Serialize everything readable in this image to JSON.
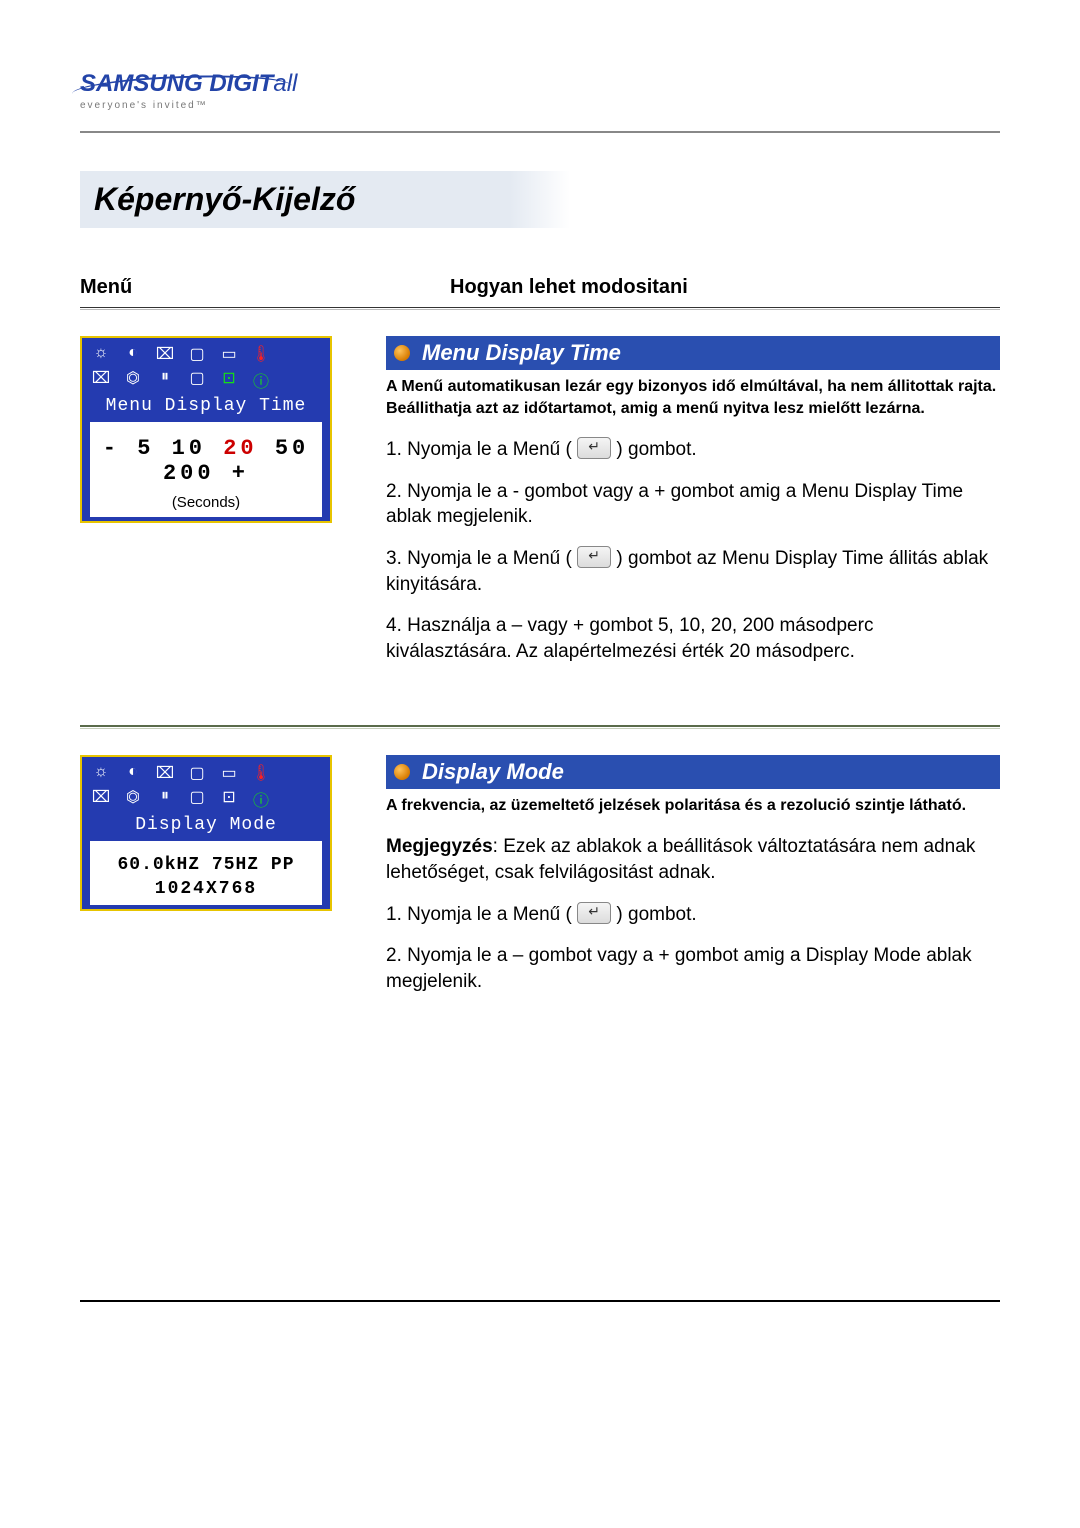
{
  "logo": {
    "line1_brand": "SAMSUNG",
    "line1_word": "DIGIT",
    "line1_suffix": "all",
    "tagline": "everyone's invited™"
  },
  "page_title": "Képernyő-Kijelző",
  "columns": {
    "menu": "Menű",
    "how": "Hogyan lehet modositani"
  },
  "osd1": {
    "title": "Menu Display Time",
    "values": [
      "5",
      "10",
      "20",
      "50",
      "200"
    ],
    "units": "(Seconds)"
  },
  "osd2": {
    "title": "Display Mode",
    "line1": "60.0kHZ 75HZ PP",
    "line2": "1024X768"
  },
  "section1": {
    "title": "Menu Display Time",
    "intro": "A Menű automatikusan lezár egy bizonyos idő elmúltával, ha nem állitottak rajta. Beállithatja azt az időtartamot, amig a menű nyitva lesz mielőtt lezárna.",
    "step1a": "1. Nyomja le a Menű  ( ",
    "step1b": " ) gombot.",
    "step2": "2. Nyomja le a - gombot vagy a + gombot amig a Menu Display Time ablak megjelenik.",
    "step3a": "3. Nyomja le a Menű ( ",
    "step3b": " ) gombot az Menu Display Time állitás ablak kinyitására.",
    "step4": "4. Használja a – vagy + gombot 5, 10, 20, 200 másodperc kiválasztására. Az alapértelmezési érték 20 másodperc."
  },
  "section2": {
    "title": "Display Mode",
    "intro": "A frekvencia, az üzemeltető jelzések polaritása és a rezolució szintje látható.",
    "note_label": "Megjegyzés",
    "note_text": ": Ezek az ablakok a beállitások változtatására nem adnak lehetőséget, csak felvilágositást adnak.",
    "step1a": "1. Nyomja le a Menű  ( ",
    "step1b": " ) gombot.",
    "step2": "2. Nyomja le a – gombot vagy a + gombot amig a Display Mode ablak megjelenik."
  }
}
